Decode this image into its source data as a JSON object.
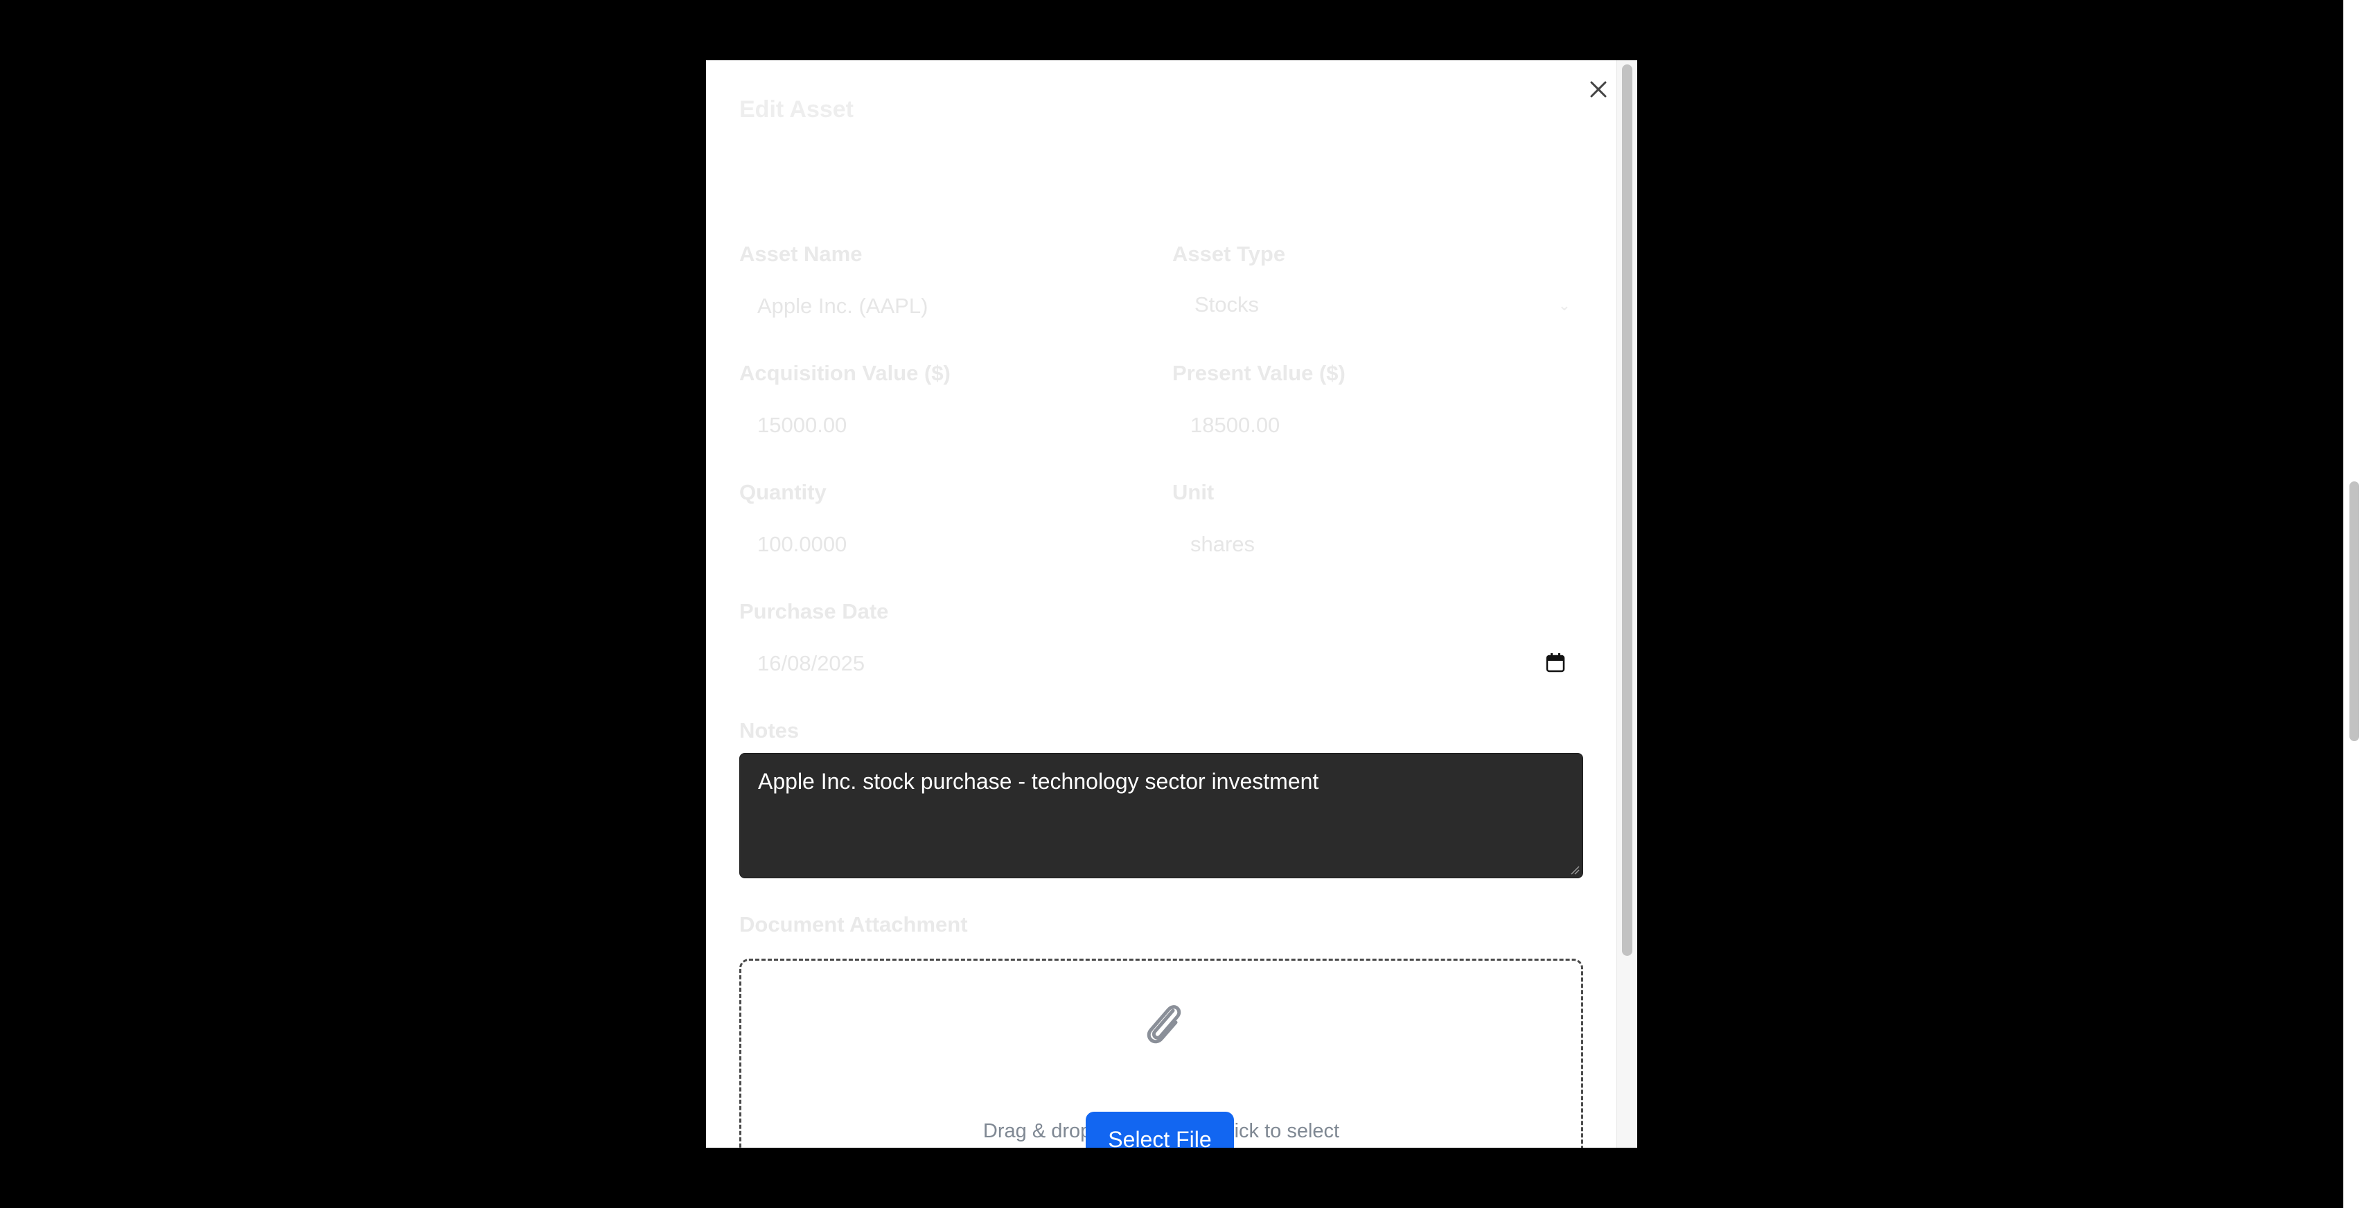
{
  "modal": {
    "title": "Edit Asset",
    "close_icon": "close-icon"
  },
  "form": {
    "asset_name": {
      "label": "Asset Name",
      "value": "Apple Inc. (AAPL)"
    },
    "asset_type": {
      "label": "Asset Type",
      "value": "Stocks",
      "icon": "chevron-down-icon"
    },
    "acquisition_value": {
      "label": "Acquisition Value ($)",
      "value": "15000.00"
    },
    "present_value": {
      "label": "Present Value ($)",
      "value": "18500.00"
    },
    "quantity": {
      "label": "Quantity",
      "value": "100.0000"
    },
    "unit": {
      "label": "Unit",
      "value": "shares"
    },
    "purchase_date": {
      "label": "Purchase Date",
      "value": "16/08/2025",
      "icon": "calendar-icon"
    },
    "notes": {
      "label": "Notes",
      "value": "Apple Inc. stock purchase - technology sector investment"
    },
    "attachment": {
      "label": "Document Attachment",
      "icon": "paperclip-icon",
      "hint": "Drag & drop a file here, or click to select",
      "button_label": "Select File"
    }
  },
  "colors": {
    "primary_button": "#1266f1",
    "notes_bg": "#2b2b2b",
    "backdrop": "#000000"
  }
}
